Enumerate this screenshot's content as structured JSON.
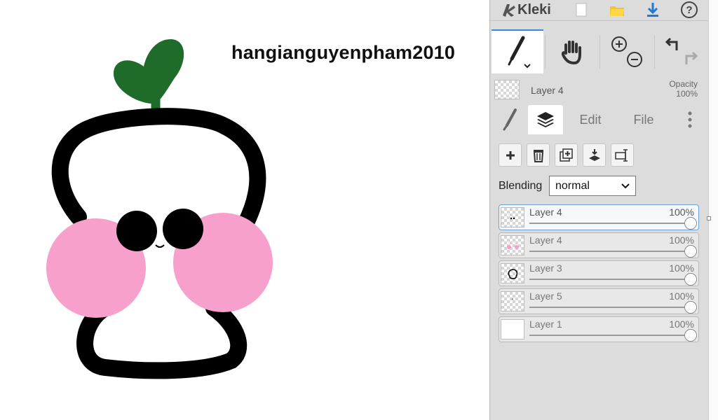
{
  "canvas": {
    "signature": "hangianguyenpham2010",
    "colors": {
      "leaf": "#1e6b2a",
      "outline": "#000000",
      "cheek": "#f7a0cb",
      "eye": "#000000",
      "background": "#ffffff"
    }
  },
  "app": {
    "logo_text": "Kleki",
    "top_buttons": [
      "new-image-icon",
      "open-folder-icon",
      "download-icon",
      "help-icon"
    ],
    "accent_color": "#3b8ad9"
  },
  "tools": {
    "items": [
      "brush-tool",
      "hand-tool",
      "zoom-in-out",
      "undo-redo"
    ],
    "active": "brush-tool"
  },
  "current_layer": {
    "name": "Layer 4",
    "opacity_label": "Opacity",
    "opacity_value": "100%"
  },
  "tabs": {
    "items": [
      {
        "icon": "brush-icon",
        "label": ""
      },
      {
        "icon": "layers-icon",
        "label": ""
      },
      {
        "icon": "",
        "label": "Edit"
      },
      {
        "icon": "",
        "label": "File"
      },
      {
        "icon": "more-icon",
        "label": ""
      }
    ],
    "active": 1
  },
  "layer_tools": [
    "add-layer",
    "delete-layer",
    "duplicate-layer",
    "merge-down",
    "rename-layer"
  ],
  "blending": {
    "label": "Blending",
    "value": "normal"
  },
  "layers": [
    {
      "name": "Layer 4",
      "opacity": "100%",
      "selected": true,
      "thumb": "face"
    },
    {
      "name": "Layer 4",
      "opacity": "100%",
      "selected": false,
      "thumb": "cheeks"
    },
    {
      "name": "Layer 3",
      "opacity": "100%",
      "selected": false,
      "thumb": "outline"
    },
    {
      "name": "Layer 5",
      "opacity": "100%",
      "selected": false,
      "thumb": "sprout"
    },
    {
      "name": "Layer 1",
      "opacity": "100%",
      "selected": false,
      "thumb": "white"
    }
  ]
}
